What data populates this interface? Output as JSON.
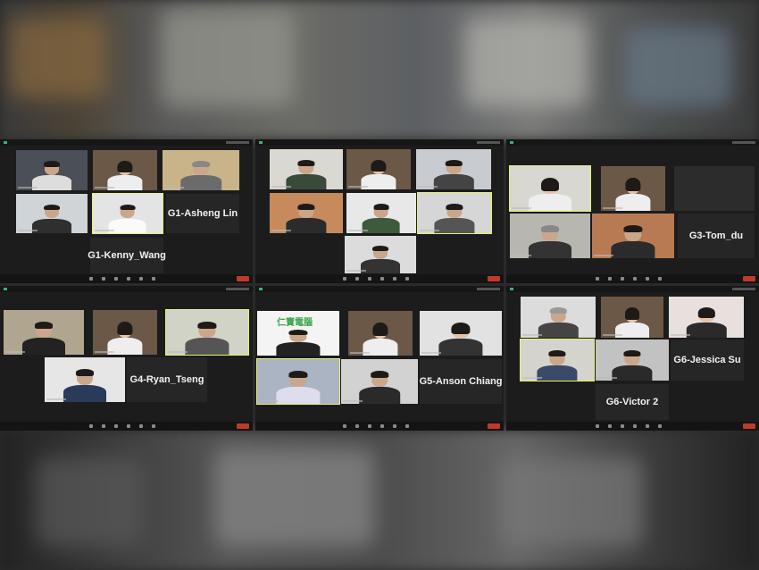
{
  "panels": [
    {
      "id": "G1",
      "name_tiles": [
        "G1-Asheng Lin",
        "G1-Kenny_Wang"
      ]
    },
    {
      "id": "G2",
      "name_tiles": []
    },
    {
      "id": "G3",
      "name_tiles": [
        "G3-Tom_du"
      ]
    },
    {
      "id": "G4",
      "name_tiles": [
        "G4-Ryan_Tseng"
      ]
    },
    {
      "id": "G5",
      "name_tiles": [
        "G5-Anson Chiang"
      ],
      "logo_text": "仁寶電腦"
    },
    {
      "id": "G6",
      "name_tiles": [
        "G6-Jessica Su",
        "G6-Victor 2"
      ]
    }
  ],
  "colors": {
    "panel_bg": "#1c1c1c",
    "name_tile_bg": "#262626",
    "active_speaker": "#e8f06a",
    "leave_button": "#c0392b"
  }
}
